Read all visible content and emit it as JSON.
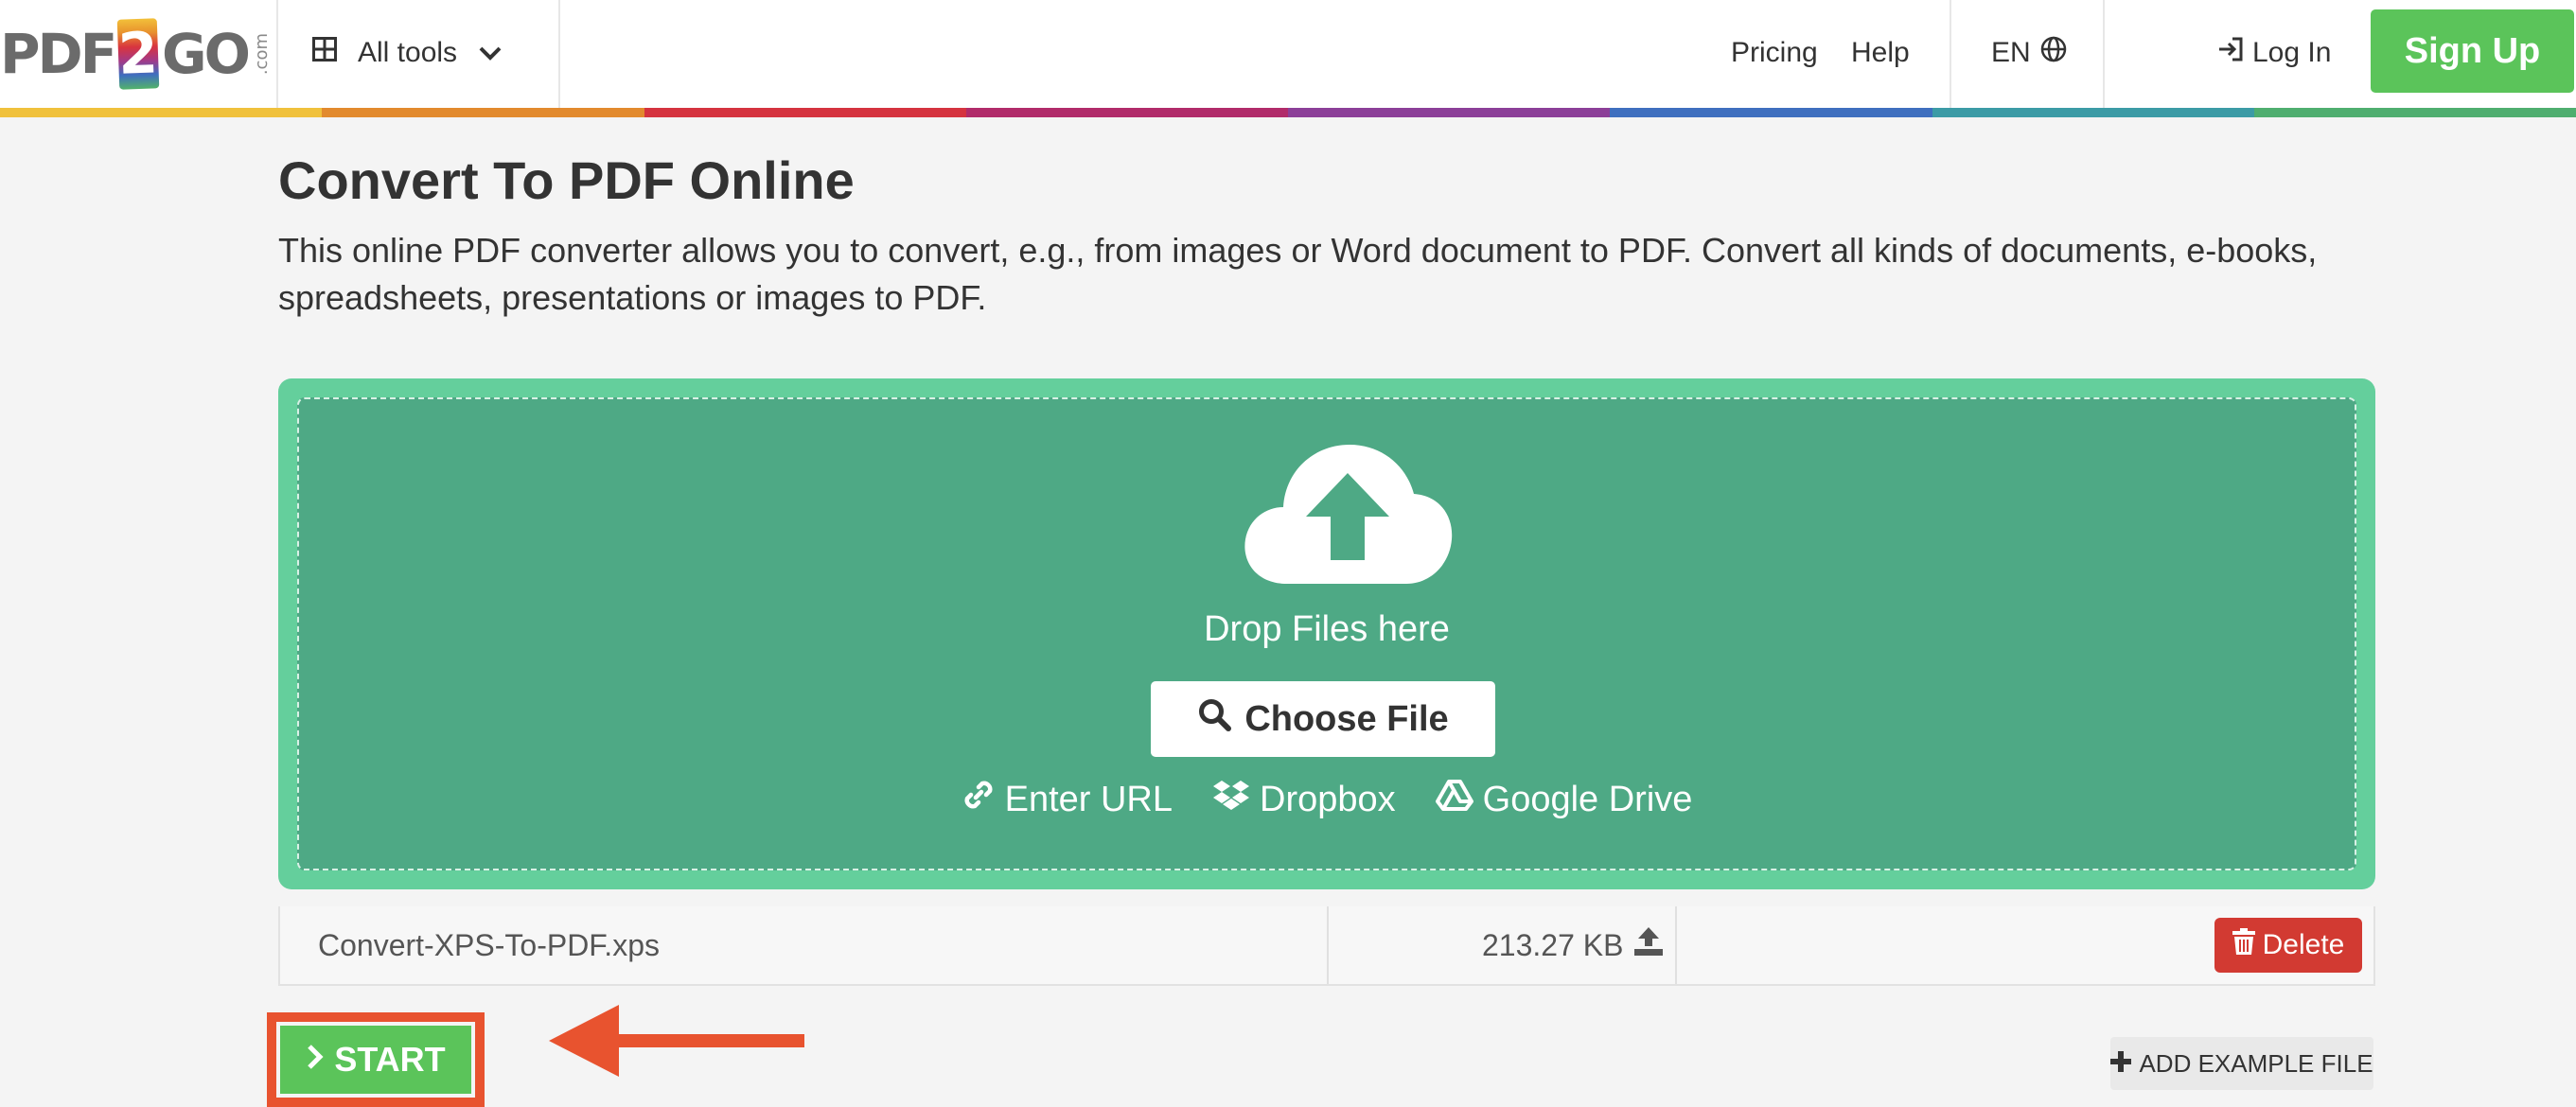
{
  "header": {
    "logo": {
      "pdf": "PDF",
      "two": "2",
      "go": "GO",
      "com": ".com"
    },
    "all_tools_label": "All tools",
    "nav": {
      "pricing": "Pricing",
      "help": "Help",
      "language": "EN"
    },
    "login_label": "Log In",
    "signup_label": "Sign Up",
    "rainbow_colors": [
      "#f0c13c",
      "#e28a2e",
      "#d5333f",
      "#b12b6a",
      "#8c3f98",
      "#3f6fbf",
      "#3c9ba6",
      "#4fae6f"
    ]
  },
  "main": {
    "title": "Convert To PDF Online",
    "description": "This online PDF converter allows you to convert, e.g., from images or Word document to PDF. Convert all kinds of documents, e-books, spreadsheets, presentations or images to PDF."
  },
  "dropzone": {
    "drop_text": "Drop Files here",
    "choose_label": "Choose File",
    "sources": {
      "url": "Enter URL",
      "dropbox": "Dropbox",
      "gdrive": "Google Drive"
    },
    "colors": {
      "outer": "#64cf9c",
      "inner": "#4ea985"
    }
  },
  "file": {
    "name": "Convert-XPS-To-PDF.xps",
    "size": "213.27 KB",
    "delete_label": "Delete"
  },
  "actions": {
    "start_label": "START",
    "example_label": "ADD EXAMPLE FILE",
    "accent_green": "#5bc45a",
    "annotation_color": "#e8532f"
  }
}
